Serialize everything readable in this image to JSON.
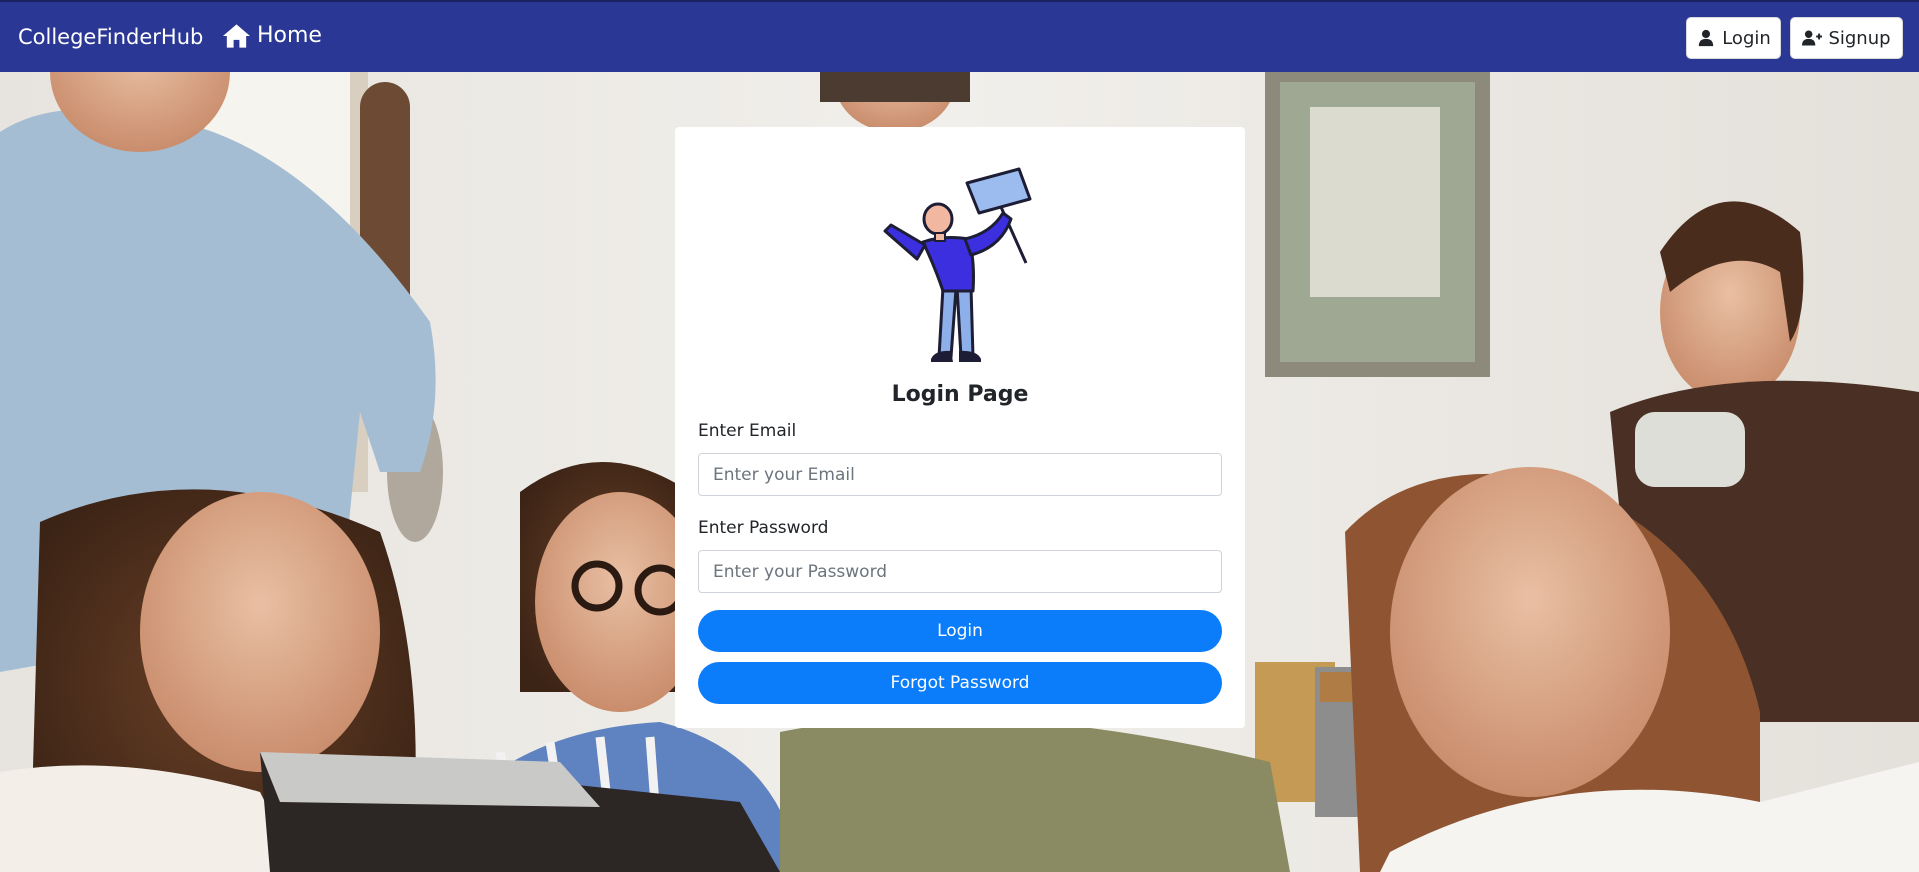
{
  "navbar": {
    "brand": "CollegeFinderHub",
    "home_label": "Home",
    "login_label": "Login",
    "signup_label": "Signup",
    "background_color": "#2a3795"
  },
  "icons": {
    "home": "home-icon",
    "user": "user-icon",
    "user_plus": "user-plus-icon",
    "illustration": "person-waving-flag-illustration"
  },
  "login_card": {
    "title": "Login Page",
    "email_label": "Enter Email",
    "email_placeholder": "Enter your Email",
    "email_value": "",
    "password_label": "Enter Password",
    "password_placeholder": "Enter your Password",
    "password_value": "",
    "login_button": "Login",
    "forgot_button": "Forgot Password",
    "button_color": "#0b7dfb"
  }
}
